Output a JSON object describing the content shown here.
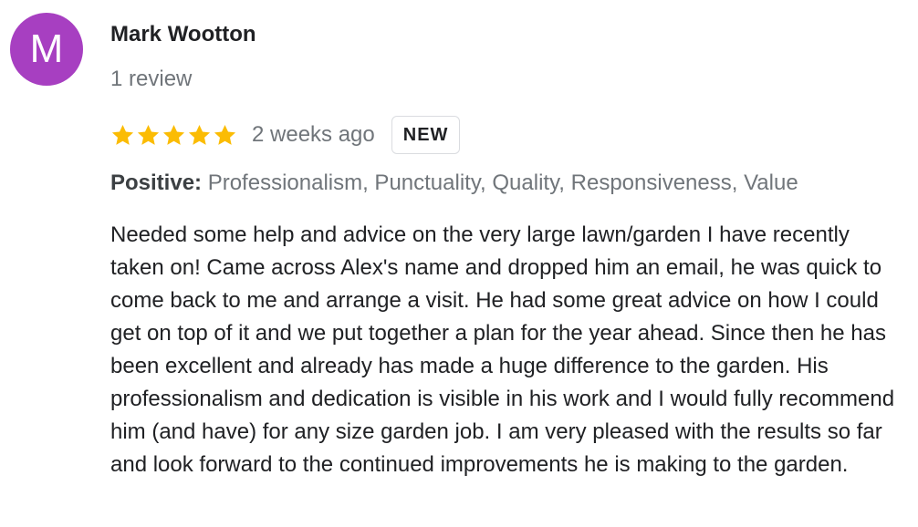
{
  "review": {
    "avatar_letter": "M",
    "avatar_color": "#a73fc1",
    "author_name": "Mark Wootton",
    "review_count": "1 review",
    "rating": 5,
    "rating_max": 5,
    "star_color": "#fbbc04",
    "time_ago": "2 weeks ago",
    "badge": "NEW",
    "attributes_label": "Positive:",
    "attributes_values": "Professionalism, Punctuality, Quality, Responsiveness, Value",
    "text": "Needed some help and advice on the very large lawn/garden I have recently taken on! Came across Alex's name and dropped him an email, he was quick to  come back to me and arrange a visit. He had some great advice on how I could get on top of it and we put together a plan for the year ahead. Since then he has been excellent and already has made a huge difference to the garden. His professionalism and dedication is visible in his work and I would fully recommend him (and have) for any size garden job. I am very pleased with the results so far and look forward to the continued improvements he is making to the garden."
  }
}
